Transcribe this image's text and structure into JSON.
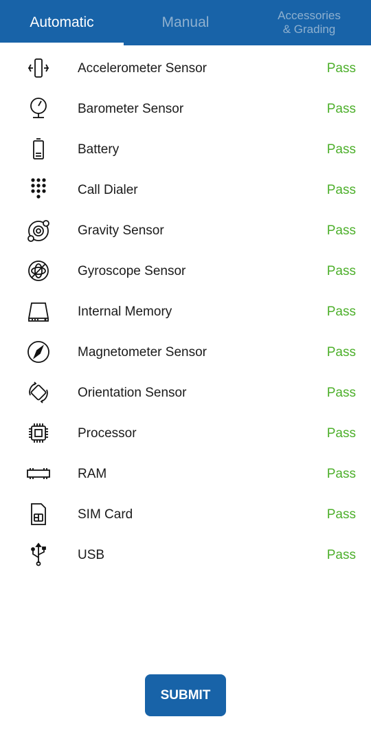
{
  "colors": {
    "primary": "#1863a8",
    "pass": "#4caf2a",
    "tab_inactive": "#8eb0cf",
    "tab_active": "#ffffff"
  },
  "tabs": [
    {
      "label": "Automatic",
      "active": true
    },
    {
      "label": "Manual",
      "active": false
    },
    {
      "label": "Accessories\n& Grading",
      "active": false
    }
  ],
  "tests": [
    {
      "name": "Accelerometer Sensor",
      "status": "Pass",
      "icon": "accelerometer-icon"
    },
    {
      "name": "Barometer Sensor",
      "status": "Pass",
      "icon": "barometer-icon"
    },
    {
      "name": "Battery",
      "status": "Pass",
      "icon": "battery-icon"
    },
    {
      "name": "Call Dialer",
      "status": "Pass",
      "icon": "dialpad-icon"
    },
    {
      "name": "Gravity Sensor",
      "status": "Pass",
      "icon": "gravity-icon"
    },
    {
      "name": "Gyroscope Sensor",
      "status": "Pass",
      "icon": "gyroscope-icon"
    },
    {
      "name": "Internal Memory",
      "status": "Pass",
      "icon": "hard-drive-icon"
    },
    {
      "name": "Magnetometer Sensor",
      "status": "Pass",
      "icon": "compass-icon"
    },
    {
      "name": "Orientation Sensor",
      "status": "Pass",
      "icon": "screen-rotation-icon"
    },
    {
      "name": "Processor",
      "status": "Pass",
      "icon": "cpu-chip-icon"
    },
    {
      "name": "RAM",
      "status": "Pass",
      "icon": "ram-module-icon"
    },
    {
      "name": "SIM Card",
      "status": "Pass",
      "icon": "sim-card-icon"
    },
    {
      "name": "USB",
      "status": "Pass",
      "icon": "usb-icon"
    }
  ],
  "submit_label": "SUBMIT"
}
